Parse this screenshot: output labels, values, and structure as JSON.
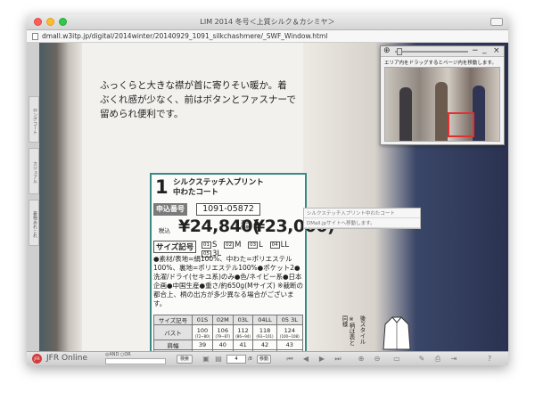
{
  "window": {
    "title": "LIM 2014 冬号＜上質シルク＆カシミヤ＞",
    "url": "dmall.w3itp.jp/digital/2014winter/20140929_1091_silkchashmere/_SWF_Window.html"
  },
  "sidebar": {
    "tabs": [
      "ロングコート",
      "カジュアル",
      "着物あれこれ"
    ]
  },
  "page": {
    "catch_copy": "ふっくらと大きな襟が首に寄りそい暖か。着ぶくれ感が少なく、前はボタンとファスナーで留められ便利です。",
    "product": {
      "number": "1",
      "name": "シルクステッチ入プリント\n中わたコート",
      "order_label": "申込番号",
      "order_number": "1091-05872",
      "tax_label": "税込",
      "price_incl": "¥24,840(",
      "base_label": "本体価格",
      "price_base": "¥23,000)",
      "size_label": "サイズ記号",
      "sizes": [
        {
          "code": "01",
          "size": "S"
        },
        {
          "code": "02",
          "size": "M"
        },
        {
          "code": "03",
          "size": "L"
        },
        {
          "code": "04",
          "size": "LL"
        },
        {
          "code": "05",
          "size": "3L"
        }
      ],
      "description": "●素材/表地=絹100%、中わた=ポリエステル100%、裏地=ポリエステル100%●ポケット2●洗濯/ドライ(セキユ系)のみ●色/ネイビー系●日本企画●中国生産●重さ/約650g(Mサイズ) ※裁断の都合上、柄の出方が多少異なる場合がございます。",
      "table": {
        "header": [
          "サイズ記号",
          "01S",
          "02M",
          "03L",
          "04LL",
          "05 3L"
        ],
        "rows": [
          {
            "label": "バスト",
            "values": [
              "100",
              "106",
              "112",
              "118",
              "124"
            ],
            "subs": [
              "(72~80)",
              "(79~87)",
              "(86~94)",
              "(93~101)",
              "(100~108)"
            ]
          },
          {
            "label": "肩幅",
            "values": [
              "39",
              "40",
              "41",
              "42",
              "43"
            ]
          },
          {
            "label": "袖丈",
            "values": [
              "58",
              "59",
              "59",
              "60",
              "60"
            ]
          },
          {
            "label": "着丈",
            "values": [
              "82",
              "83",
              "83",
              "84",
              "84"
            ]
          }
        ]
      },
      "back_style": "後スタイル",
      "back_note": "※柄は表と同様"
    }
  },
  "tooltip": {
    "lines": [
      "シルクステッチ入プリント中わたコート",
      "DMall.jpサイトへ移動します。"
    ]
  },
  "navigator": {
    "hint": "エリア内をドラッグするとページ内を移動します。",
    "zoom_in_icon": "⊕",
    "zoom_out_icon": "−",
    "minimize_icon": "_",
    "close_icon": "×"
  },
  "toolbar": {
    "brand": "JFR Online",
    "and_or": "◎AND ○OR",
    "search_label": "検索",
    "page_value": "4",
    "page_total": "/8",
    "move_label": "移動"
  }
}
